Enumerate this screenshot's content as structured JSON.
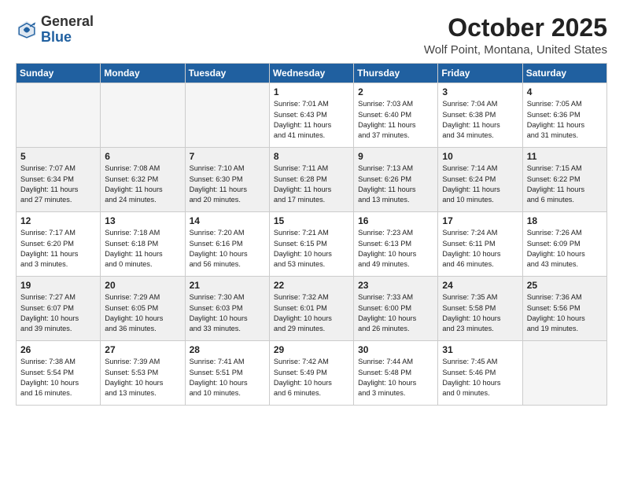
{
  "header": {
    "logo_general": "General",
    "logo_blue": "Blue",
    "month": "October 2025",
    "location": "Wolf Point, Montana, United States"
  },
  "weekdays": [
    "Sunday",
    "Monday",
    "Tuesday",
    "Wednesday",
    "Thursday",
    "Friday",
    "Saturday"
  ],
  "weeks": [
    [
      {
        "day": "",
        "info": ""
      },
      {
        "day": "",
        "info": ""
      },
      {
        "day": "",
        "info": ""
      },
      {
        "day": "1",
        "info": "Sunrise: 7:01 AM\nSunset: 6:43 PM\nDaylight: 11 hours\nand 41 minutes."
      },
      {
        "day": "2",
        "info": "Sunrise: 7:03 AM\nSunset: 6:40 PM\nDaylight: 11 hours\nand 37 minutes."
      },
      {
        "day": "3",
        "info": "Sunrise: 7:04 AM\nSunset: 6:38 PM\nDaylight: 11 hours\nand 34 minutes."
      },
      {
        "day": "4",
        "info": "Sunrise: 7:05 AM\nSunset: 6:36 PM\nDaylight: 11 hours\nand 31 minutes."
      }
    ],
    [
      {
        "day": "5",
        "info": "Sunrise: 7:07 AM\nSunset: 6:34 PM\nDaylight: 11 hours\nand 27 minutes."
      },
      {
        "day": "6",
        "info": "Sunrise: 7:08 AM\nSunset: 6:32 PM\nDaylight: 11 hours\nand 24 minutes."
      },
      {
        "day": "7",
        "info": "Sunrise: 7:10 AM\nSunset: 6:30 PM\nDaylight: 11 hours\nand 20 minutes."
      },
      {
        "day": "8",
        "info": "Sunrise: 7:11 AM\nSunset: 6:28 PM\nDaylight: 11 hours\nand 17 minutes."
      },
      {
        "day": "9",
        "info": "Sunrise: 7:13 AM\nSunset: 6:26 PM\nDaylight: 11 hours\nand 13 minutes."
      },
      {
        "day": "10",
        "info": "Sunrise: 7:14 AM\nSunset: 6:24 PM\nDaylight: 11 hours\nand 10 minutes."
      },
      {
        "day": "11",
        "info": "Sunrise: 7:15 AM\nSunset: 6:22 PM\nDaylight: 11 hours\nand 6 minutes."
      }
    ],
    [
      {
        "day": "12",
        "info": "Sunrise: 7:17 AM\nSunset: 6:20 PM\nDaylight: 11 hours\nand 3 minutes."
      },
      {
        "day": "13",
        "info": "Sunrise: 7:18 AM\nSunset: 6:18 PM\nDaylight: 11 hours\nand 0 minutes."
      },
      {
        "day": "14",
        "info": "Sunrise: 7:20 AM\nSunset: 6:16 PM\nDaylight: 10 hours\nand 56 minutes."
      },
      {
        "day": "15",
        "info": "Sunrise: 7:21 AM\nSunset: 6:15 PM\nDaylight: 10 hours\nand 53 minutes."
      },
      {
        "day": "16",
        "info": "Sunrise: 7:23 AM\nSunset: 6:13 PM\nDaylight: 10 hours\nand 49 minutes."
      },
      {
        "day": "17",
        "info": "Sunrise: 7:24 AM\nSunset: 6:11 PM\nDaylight: 10 hours\nand 46 minutes."
      },
      {
        "day": "18",
        "info": "Sunrise: 7:26 AM\nSunset: 6:09 PM\nDaylight: 10 hours\nand 43 minutes."
      }
    ],
    [
      {
        "day": "19",
        "info": "Sunrise: 7:27 AM\nSunset: 6:07 PM\nDaylight: 10 hours\nand 39 minutes."
      },
      {
        "day": "20",
        "info": "Sunrise: 7:29 AM\nSunset: 6:05 PM\nDaylight: 10 hours\nand 36 minutes."
      },
      {
        "day": "21",
        "info": "Sunrise: 7:30 AM\nSunset: 6:03 PM\nDaylight: 10 hours\nand 33 minutes."
      },
      {
        "day": "22",
        "info": "Sunrise: 7:32 AM\nSunset: 6:01 PM\nDaylight: 10 hours\nand 29 minutes."
      },
      {
        "day": "23",
        "info": "Sunrise: 7:33 AM\nSunset: 6:00 PM\nDaylight: 10 hours\nand 26 minutes."
      },
      {
        "day": "24",
        "info": "Sunrise: 7:35 AM\nSunset: 5:58 PM\nDaylight: 10 hours\nand 23 minutes."
      },
      {
        "day": "25",
        "info": "Sunrise: 7:36 AM\nSunset: 5:56 PM\nDaylight: 10 hours\nand 19 minutes."
      }
    ],
    [
      {
        "day": "26",
        "info": "Sunrise: 7:38 AM\nSunset: 5:54 PM\nDaylight: 10 hours\nand 16 minutes."
      },
      {
        "day": "27",
        "info": "Sunrise: 7:39 AM\nSunset: 5:53 PM\nDaylight: 10 hours\nand 13 minutes."
      },
      {
        "day": "28",
        "info": "Sunrise: 7:41 AM\nSunset: 5:51 PM\nDaylight: 10 hours\nand 10 minutes."
      },
      {
        "day": "29",
        "info": "Sunrise: 7:42 AM\nSunset: 5:49 PM\nDaylight: 10 hours\nand 6 minutes."
      },
      {
        "day": "30",
        "info": "Sunrise: 7:44 AM\nSunset: 5:48 PM\nDaylight: 10 hours\nand 3 minutes."
      },
      {
        "day": "31",
        "info": "Sunrise: 7:45 AM\nSunset: 5:46 PM\nDaylight: 10 hours\nand 0 minutes."
      },
      {
        "day": "",
        "info": ""
      }
    ]
  ]
}
